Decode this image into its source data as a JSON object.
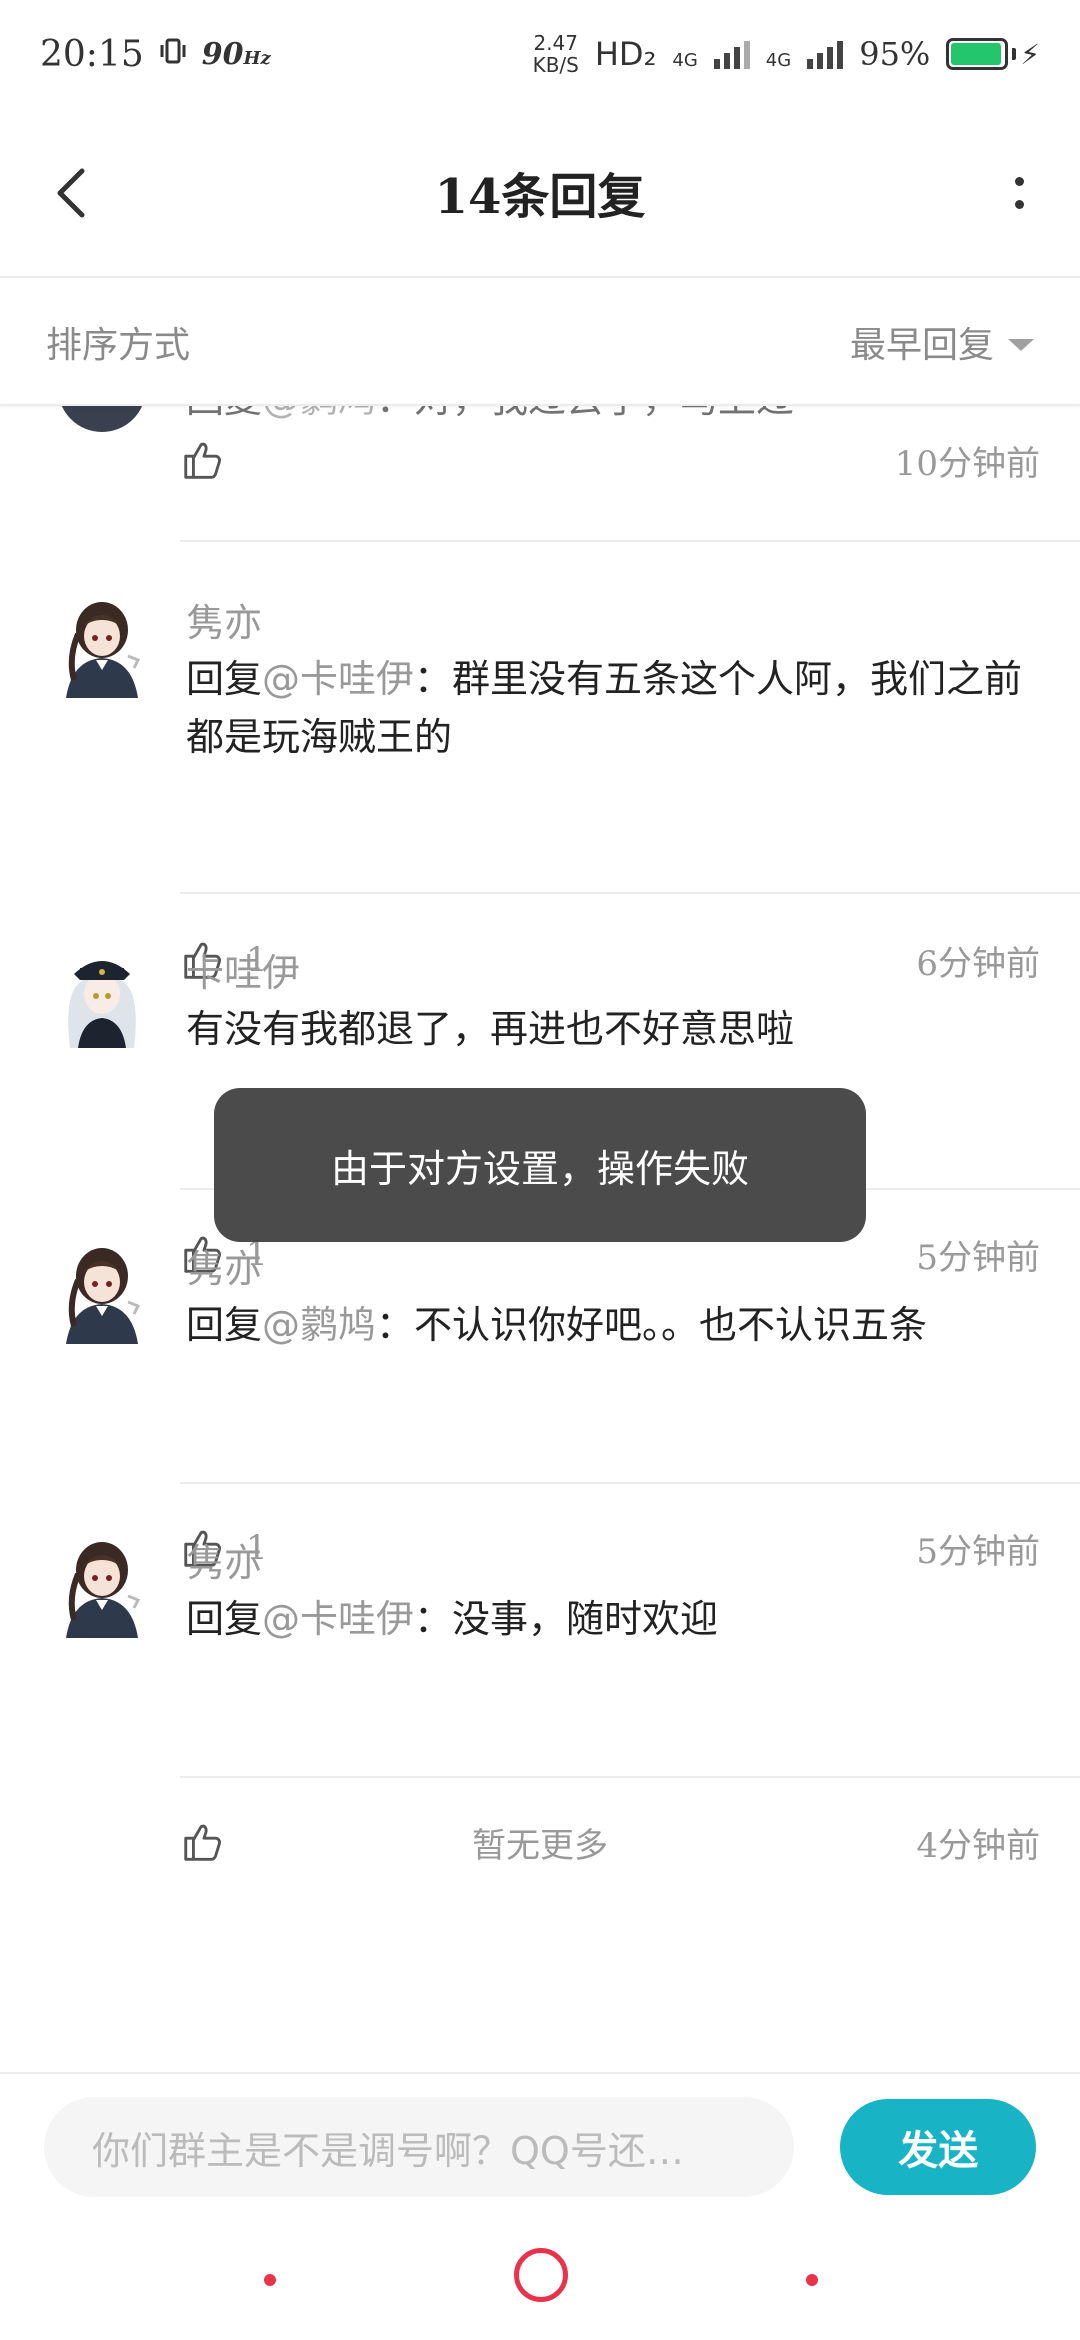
{
  "status_bar": {
    "time": "20:15",
    "refresh_rate": "90",
    "refresh_unit": "Hz",
    "speed_value": "2.47",
    "speed_unit": "KB/S",
    "hd": "HD₂",
    "net1": "4G",
    "net2": "4G",
    "battery": "95%",
    "battery_level": 0.95,
    "battery_color": "#23c66a"
  },
  "header": {
    "title": "14条回复"
  },
  "sort_bar": {
    "label": "排序方式",
    "selected": "最早回复"
  },
  "partial_reply": {
    "prefix": "回复",
    "mention": "@鹲鸠",
    "text": "：对，我过去了，马上过",
    "time": "10分钟前"
  },
  "replies": [
    {
      "username": "隽亦",
      "prefix": "回复",
      "mention": "@卡哇伊",
      "text": "：群里没有五条这个人阿，我们之前都是玩海贼王的",
      "likes": "1",
      "time": "6分钟前"
    },
    {
      "username": "卡哇伊",
      "prefix": "",
      "mention": "",
      "text": "有没有我都退了，再进也不好意思啦",
      "likes": "1",
      "time": "5分钟前"
    },
    {
      "username": "隽亦",
      "prefix": "回复",
      "mention": "@鹲鸠",
      "text": "：不认识你好吧。。也不认识五条",
      "likes": "1",
      "time": "5分钟前"
    },
    {
      "username": "隽亦",
      "prefix": "回复",
      "mention": "@卡哇伊",
      "text": "：没事，随时欢迎",
      "likes": "",
      "time": "4分钟前"
    }
  ],
  "no_more": "暂无更多",
  "toast": "由于对方设置，操作失败",
  "input_bar": {
    "placeholder": "你们群主是不是调号啊？QQ号还…",
    "send": "发送",
    "send_color": "#18b4c6"
  },
  "colors": {
    "accent": "#18b4c6",
    "nav": "#e8334a",
    "muted_text": "#999999"
  }
}
